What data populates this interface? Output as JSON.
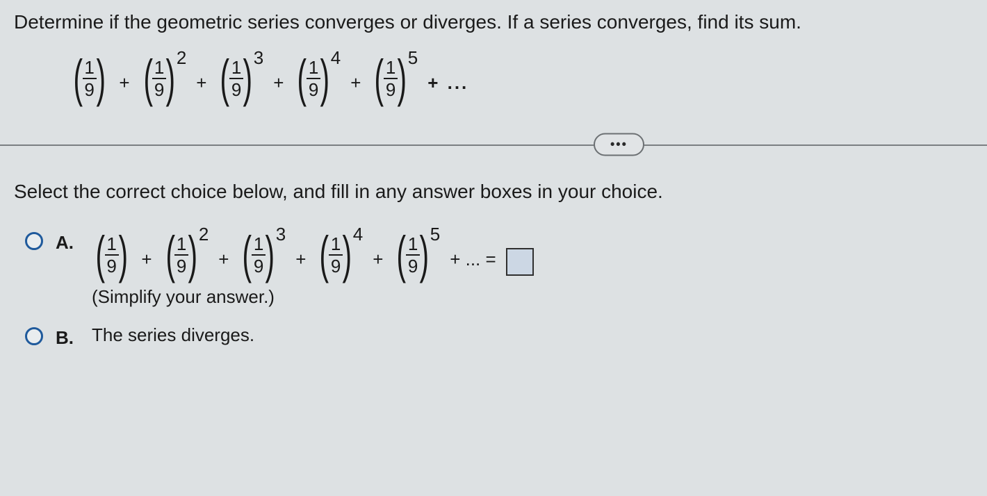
{
  "question": "Determine if the geometric series converges or diverges. If a series converges, find its sum.",
  "series": {
    "frac_num": "1",
    "frac_den": "9",
    "exp2": "2",
    "exp3": "3",
    "exp4": "4",
    "exp5": "5",
    "plus": "+",
    "dots": "...",
    "plusdots": "+ ..."
  },
  "pill": "•••",
  "sub_instruction": "Select the correct choice below, and fill in any answer boxes in your choice.",
  "choice_a": {
    "label": "A.",
    "tail": "+ ... =",
    "simplify": "(Simplify your answer.)"
  },
  "choice_b": {
    "label": "B.",
    "text": "The series diverges."
  }
}
